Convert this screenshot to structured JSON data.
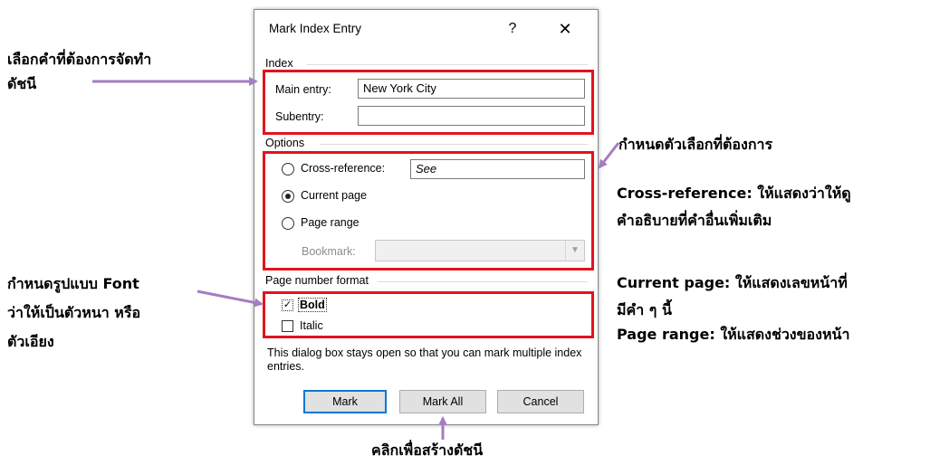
{
  "dialog": {
    "title": "Mark Index Entry",
    "help_label": "?",
    "close_label": "✕",
    "index_group": "Index",
    "main_entry_label": "Main entry:",
    "main_entry_value": "New York City",
    "subentry_label": "Subentry:",
    "subentry_value": "",
    "options_group": "Options",
    "cross_reference_label": "Cross-reference:",
    "cross_reference_value": "See",
    "current_page_label": "Current page",
    "page_range_label": "Page range",
    "bookmark_label": "Bookmark:",
    "bookmark_value": "",
    "selected_option": "Current page",
    "page_number_format_group": "Page number format",
    "bold_label": "Bold",
    "bold_checked": true,
    "italic_label": "Italic",
    "italic_checked": false,
    "note": "This dialog box stays open so that you can mark multiple index entries.",
    "mark_button": "Mark",
    "mark_all_button": "Mark All",
    "cancel_button": "Cancel"
  },
  "annotations": {
    "select_word_line1": "เลือกคำที่ต้องการจัดทำ",
    "select_word_line2": "ดัชนี",
    "options_title": "กำหนดตัวเลือกที่ต้องการ",
    "cross_ref_line1": "Cross-reference: ให้แสดงว่าให้ดู",
    "cross_ref_line2": "คำอธิบายที่คำอื่นเพิ่มเติม",
    "current_page_line1": "Current page: ให้แสดงเลขหน้าที่",
    "current_page_line2": "มีคำ ๆ นี้",
    "page_range_line": "Page range: ให้แสดงช่วงของหน้า",
    "font_line1": "กำหนดรูปแบบ Font",
    "font_line2": "ว่าให้เป็นตัวหนา หรือ",
    "font_line3": "ตัวเอียง",
    "click_create": "คลิกเพื่อสร้างดัชนี"
  },
  "colors": {
    "highlight_border": "#e0141e",
    "arrow": "#a57dc2",
    "default_button_border": "#0078d7"
  }
}
